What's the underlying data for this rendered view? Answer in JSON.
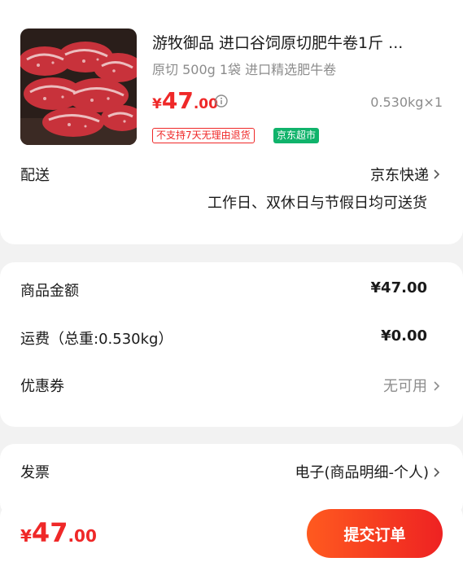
{
  "product": {
    "title": "游牧御品 进口谷饲原切肥牛卷1斤 ...",
    "spec": "原切 500g 1袋 进口精选肥牛卷",
    "price_currency": "¥",
    "price_int": "47",
    "price_dec": ".00",
    "quantity": "0.530kg×1",
    "badge_return": "不支持7天无理由退货",
    "badge_jd": "京东超市",
    "info_icon": "info-circle-icon"
  },
  "delivery": {
    "label": "配送",
    "value": "京东快递",
    "note": "工作日、双休日与节假日均可送货"
  },
  "cost": {
    "goods_label": "商品金额",
    "goods_value": "¥47.00",
    "shipping_label": "运费（总重:0.530kg）",
    "shipping_value": "¥0.00",
    "coupon_label": "优惠券",
    "coupon_value": "无可用"
  },
  "invoice": {
    "label": "发票",
    "value": "电子(商品明细-个人)"
  },
  "footer": {
    "total_currency": "¥",
    "total_int": "47",
    "total_dec": ".00",
    "submit_label": "提交订单"
  },
  "colors": {
    "accent_red": "#ef2828",
    "jd_green": "#10b36b",
    "submit_gradient_start": "#ff5a1f",
    "submit_gradient_end": "#ee2222",
    "muted_text": "#8c8c8c",
    "page_bg": "#f2f2f2"
  }
}
